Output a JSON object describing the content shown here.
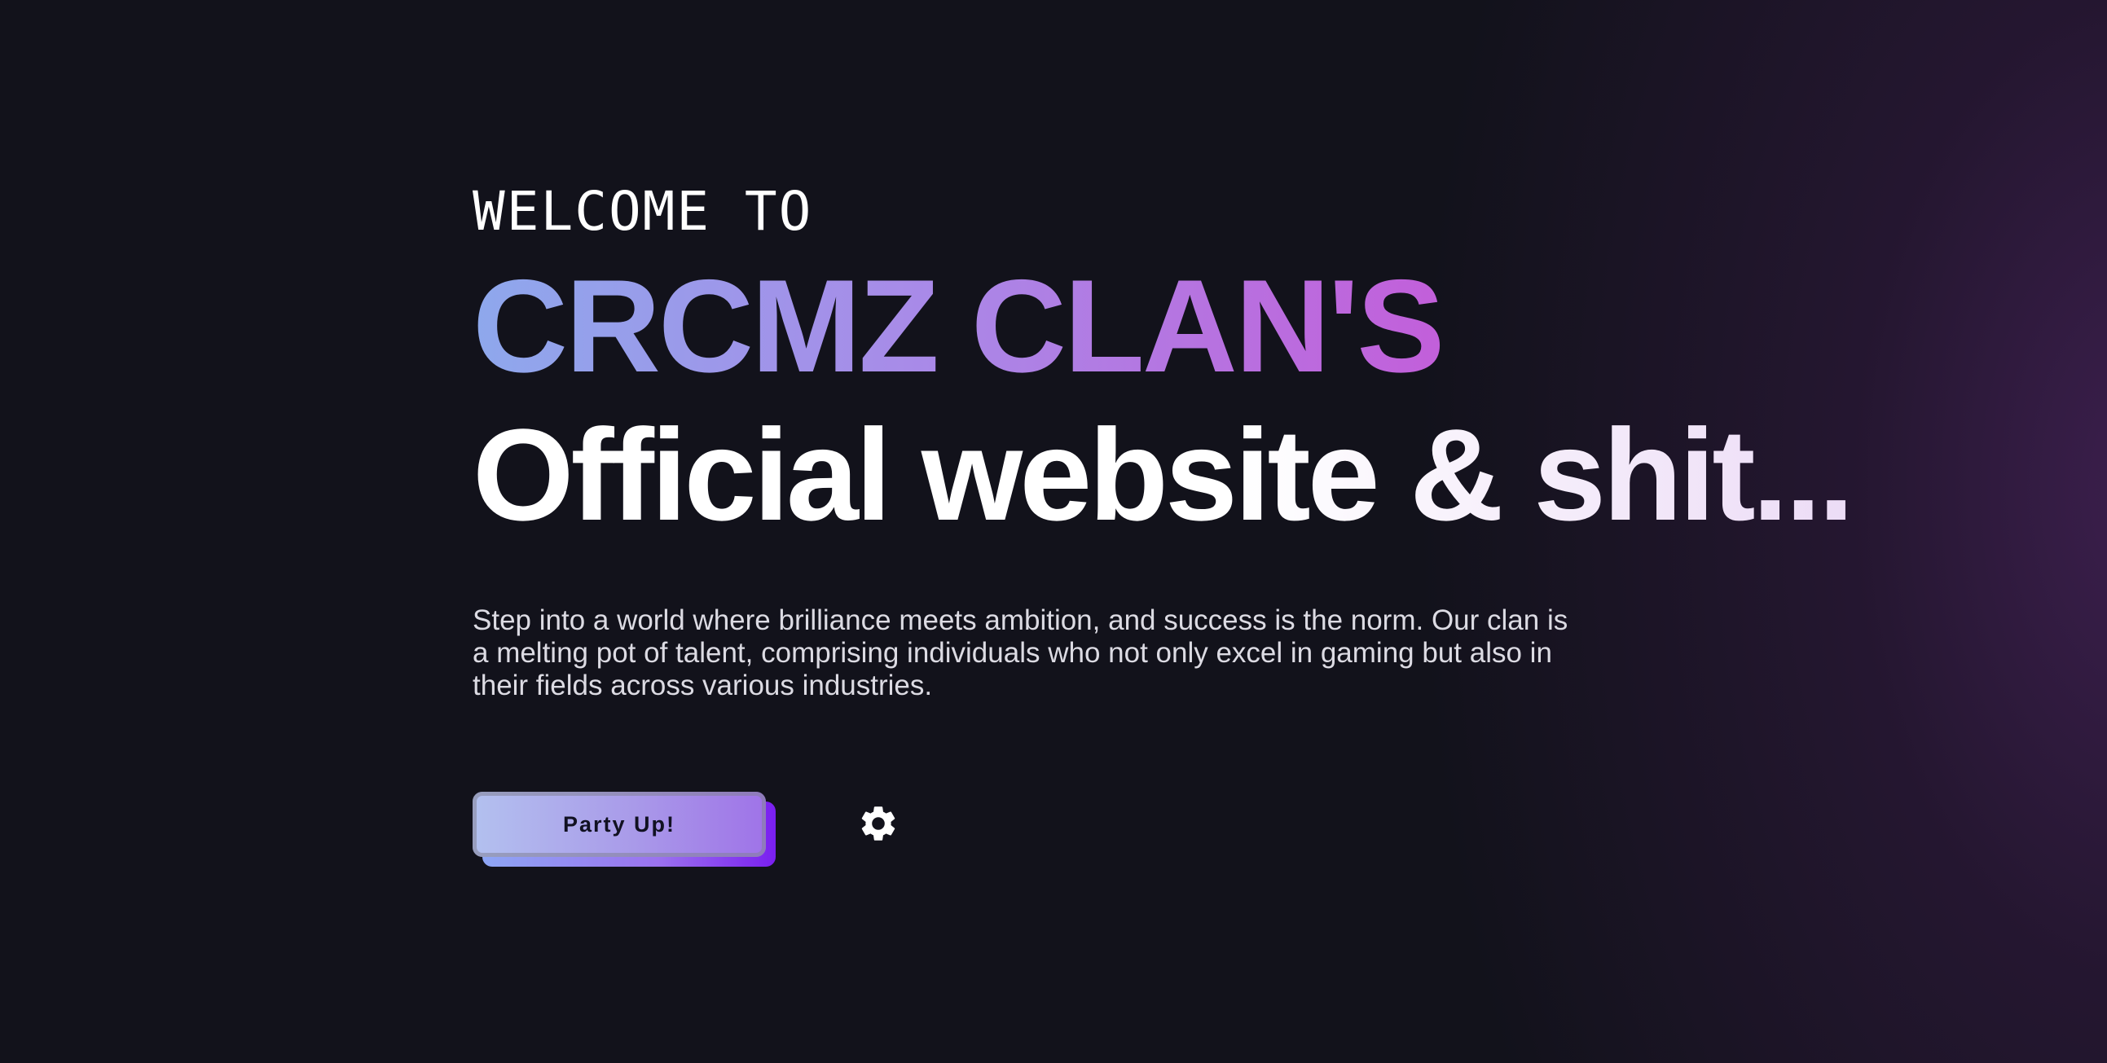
{
  "hero": {
    "welcome": "WELCOME TO",
    "clan_name": "CRCMZ CLAN'S",
    "subtitle": "Official website & shit...",
    "description": "Step into a world where brilliance meets ambition, and success is the norm. Our clan is a melting pot of talent, comprising individuals who not only excel in gaming but also in their fields across various industries."
  },
  "actions": {
    "party_button_label": "Party Up!",
    "settings_icon": "gear-icon"
  },
  "colors": {
    "background": "#12121b",
    "accent_gradient_start": "#8ea8ec",
    "accent_gradient_end": "#c25fda",
    "button_shadow_end": "#7a1ff0"
  }
}
